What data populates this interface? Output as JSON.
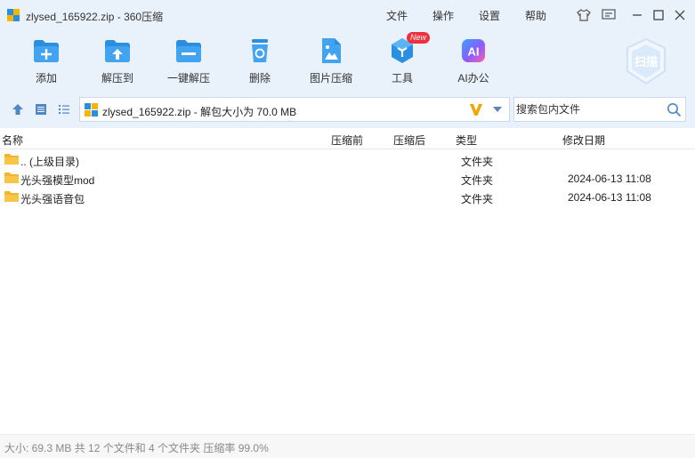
{
  "window": {
    "title": "zlysed_165922.zip - 360压缩",
    "menus": [
      "文件",
      "操作",
      "设置",
      "帮助"
    ]
  },
  "toolbar": {
    "buttons": [
      {
        "label": "添加",
        "icon": "add-icon"
      },
      {
        "label": "解压到",
        "icon": "extract-to-icon"
      },
      {
        "label": "一键解压",
        "icon": "one-click-extract-icon"
      },
      {
        "label": "删除",
        "icon": "delete-icon"
      },
      {
        "label": "图片压缩",
        "icon": "image-compress-icon"
      },
      {
        "label": "工具",
        "icon": "tools-icon",
        "badge": "New"
      },
      {
        "label": "AI办公",
        "icon": "ai-office-icon",
        "icon_text": "AI"
      }
    ],
    "scan_label": "扫描"
  },
  "address": {
    "path": "zlysed_165922.zip - 解包大小为 70.0 MB"
  },
  "search": {
    "placeholder": "搜索包内文件"
  },
  "columns": {
    "name": "名称",
    "compressed_before": "压缩前",
    "compressed_after": "压缩后",
    "type": "类型",
    "modified": "修改日期"
  },
  "files": [
    {
      "name": ".. (上级目录)",
      "type": "文件夹",
      "modified": ""
    },
    {
      "name": "光头强模型mod",
      "type": "文件夹",
      "modified": "2024-06-13 11:08"
    },
    {
      "name": "光头强语音包",
      "type": "文件夹",
      "modified": "2024-06-13 11:08"
    }
  ],
  "status": {
    "text": "大小: 69.3 MB 共 12 个文件和 4 个文件夹 压缩率 99.0%"
  },
  "colors": {
    "chrome_bg": "#e9f1fb",
    "icon_blue": "#2a8fe0",
    "folder_yellow": "#f7c648",
    "new_badge": "#ef2f3b"
  }
}
